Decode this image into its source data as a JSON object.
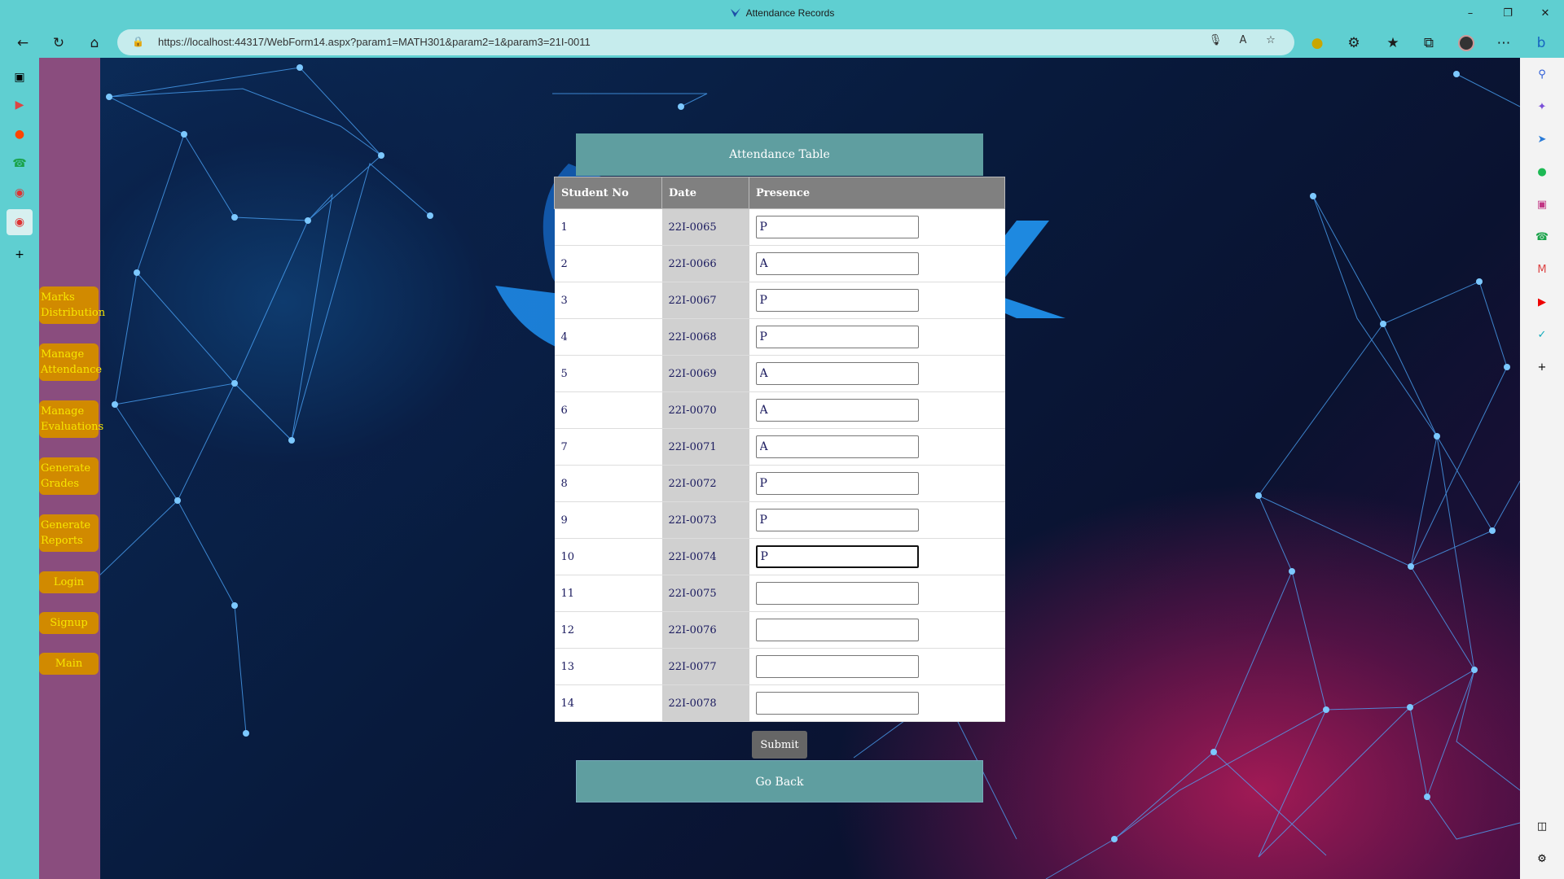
{
  "window": {
    "title": "Attendance Records",
    "controls": [
      "minimize",
      "restore",
      "close"
    ]
  },
  "toolbar": {
    "url": "https://localhost:44317/WebForm14.aspx?param1=MATH301&param2=1&param3=21I-0011"
  },
  "nav": {
    "items": [
      {
        "label": "Marks Distribution"
      },
      {
        "label": "Manage Attendance"
      },
      {
        "label": "Manage Evaluations"
      },
      {
        "label": "Generate Grades"
      },
      {
        "label": "Generate Reports"
      },
      {
        "label": "Login"
      },
      {
        "label": "Signup"
      },
      {
        "label": "Main"
      }
    ]
  },
  "panel": {
    "title": "Attendance Table",
    "columns": [
      "Student No",
      "Date",
      "Presence"
    ],
    "rows": [
      {
        "no": "1",
        "date": "22I-0065",
        "presence": "P"
      },
      {
        "no": "2",
        "date": "22I-0066",
        "presence": "A"
      },
      {
        "no": "3",
        "date": "22I-0067",
        "presence": "P"
      },
      {
        "no": "4",
        "date": "22I-0068",
        "presence": "P"
      },
      {
        "no": "5",
        "date": "22I-0069",
        "presence": "A"
      },
      {
        "no": "6",
        "date": "22I-0070",
        "presence": "A"
      },
      {
        "no": "7",
        "date": "22I-0071",
        "presence": "A"
      },
      {
        "no": "8",
        "date": "22I-0072",
        "presence": "P"
      },
      {
        "no": "9",
        "date": "22I-0073",
        "presence": "P"
      },
      {
        "no": "10",
        "date": "22I-0074",
        "presence": "P"
      },
      {
        "no": "11",
        "date": "22I-0075",
        "presence": ""
      },
      {
        "no": "12",
        "date": "22I-0076",
        "presence": ""
      },
      {
        "no": "13",
        "date": "22I-0077",
        "presence": ""
      },
      {
        "no": "14",
        "date": "22I-0078",
        "presence": ""
      }
    ],
    "submit_label": "Submit",
    "goback_label": "Go Back"
  },
  "colors": {
    "browser_chrome": "#5fcfd1",
    "nav_sidebar": "#8a4d7e",
    "nav_button": "#d18a00",
    "nav_text": "#f7e600",
    "panel_header": "#5f9ea0",
    "table_header": "#808080"
  },
  "edge_left_icons": [
    "tab-actions-icon",
    "youtube-icon",
    "reddit-icon",
    "whatsapp-icon",
    "record-icon",
    "record-active-icon",
    "add-icon"
  ],
  "edge_right_icons": [
    "bing-icon",
    "search-icon",
    "copilot-icon",
    "send-icon",
    "spotify-icon",
    "instagram-icon",
    "whatsapp-icon",
    "gmail-icon",
    "youtube-icon",
    "tool-icon",
    "add-icon",
    "panel-icon",
    "settings-icon"
  ]
}
